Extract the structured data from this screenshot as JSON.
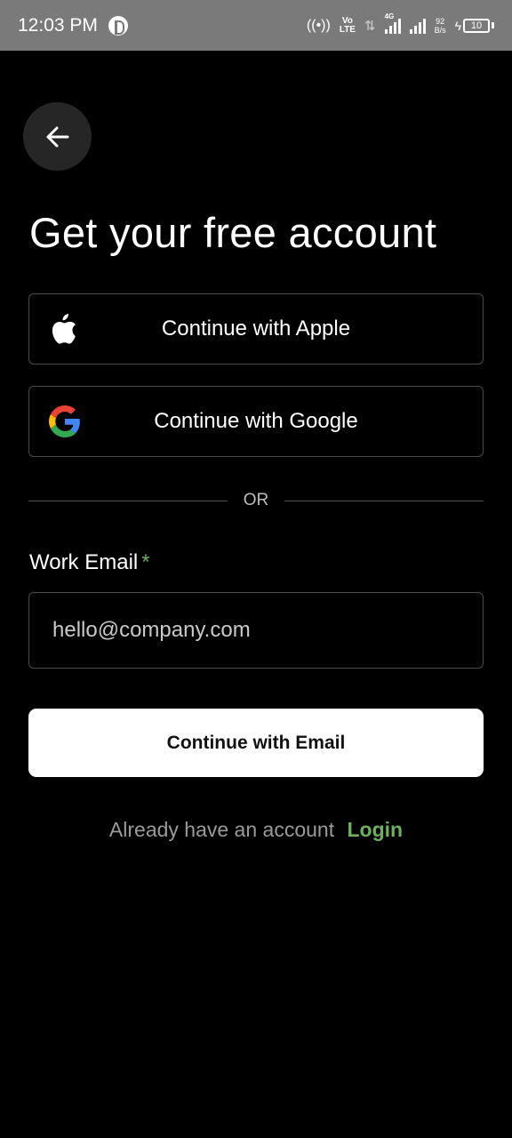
{
  "status_bar": {
    "time": "12:03 PM",
    "volte_top": "Vo",
    "volte_bottom": "LTE",
    "network": "4G",
    "speed_value": "92",
    "speed_unit": "B/s",
    "battery": "10"
  },
  "title": "Get your free account",
  "buttons": {
    "apple_label": "Continue with Apple",
    "google_label": "Continue with Google",
    "email_label": "Continue with Email"
  },
  "divider_text": "OR",
  "email_field": {
    "label": "Work Email",
    "required_marker": "*",
    "placeholder": "hello@company.com",
    "value": ""
  },
  "footer": {
    "prompt": "Already have an account",
    "login_label": "Login"
  },
  "colors": {
    "background": "#000000",
    "accent_green": "#6fae5d",
    "status_bar": "#7a7a7a",
    "primary_button": "#ffffff"
  }
}
